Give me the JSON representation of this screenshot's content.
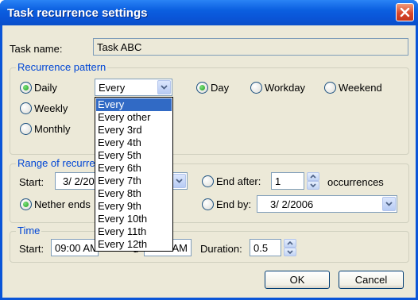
{
  "window": {
    "title": "Task recurrence settings"
  },
  "task": {
    "label": "Task name:",
    "value": "Task ABC"
  },
  "recurrence": {
    "group_title": "Recurrence pattern",
    "daily": "Daily",
    "weekly": "Weekly",
    "monthly": "Monthly",
    "every_value": "Every",
    "day": "Day",
    "workday": "Workday",
    "weekend": "Weekend",
    "selected_pattern": "Daily",
    "selected_unit": "Day"
  },
  "dropdown": {
    "options": [
      "Every",
      "Every other",
      "Every 3rd",
      "Every 4th",
      "Every 5th",
      "Every 6th",
      "Every 7th",
      "Every 8th",
      "Every 9th",
      "Every 10th",
      "Every 11th",
      "Every 12th"
    ],
    "selected": "Every"
  },
  "range": {
    "group_title": "Range of recurre",
    "start_label": "Start:",
    "start_value": "3/  2/20",
    "neither": "Nether ends",
    "end_after": "End after:",
    "occurrences_value": "1",
    "occurrences_label": "occurrences",
    "end_by": "End by:",
    "end_by_value": "3/  2/2006",
    "selected": "Nether ends"
  },
  "time": {
    "group_title": "Time",
    "start_label": "Start:",
    "start_value": "09:00 AM",
    "end_value": "AM",
    "end_label_partial": "d",
    "duration_label": "Duration:",
    "duration_value": "0.5"
  },
  "buttons": {
    "ok": "OK",
    "cancel": "Cancel"
  },
  "icons": {
    "close": "close-icon",
    "combo_arrow": "chevron-down-icon",
    "spin_up": "chevron-up-icon",
    "spin_down": "chevron-down-icon"
  },
  "colors": {
    "title_bar": "#0a55d8",
    "dialog_bg": "#ece9d8",
    "group_title": "#0046d5",
    "selection": "#316ac5",
    "close_button": "#d8482c"
  }
}
